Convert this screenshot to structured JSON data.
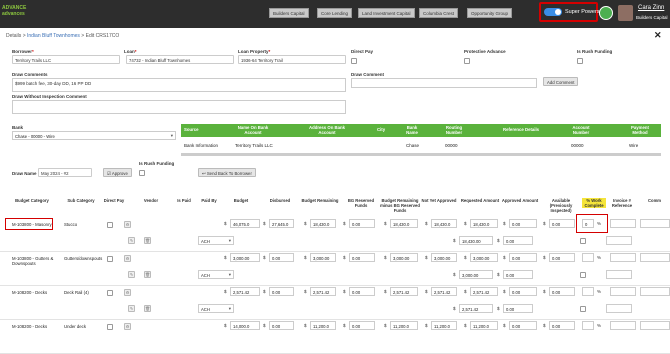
{
  "app": {
    "logo_line1": "ADVANCE",
    "logo_line2": "advances"
  },
  "nav": {
    "tabs": [
      "Builders Capital",
      "Core Lending",
      "Land Investment Capital",
      "Columbia Crest",
      "Opportunity Group"
    ],
    "super_powers_label": "Super Powers",
    "user_name": "Cara Zinn",
    "user_company": "Builders Capital"
  },
  "breadcrumb": {
    "root": "Details",
    "sep": ">",
    "project": "Indian Bluff Townhomes",
    "current": "Edit CRS17CO"
  },
  "form": {
    "borrower_label": "Borrower",
    "borrower_value": "Territory Trails LLC",
    "loan_label": "Loan",
    "loan_value": "74732 - Indian Bluff Townhomes",
    "loan_property_label": "Loan Property",
    "loan_property_value": "1936-64 Territory Trail",
    "direct_pay_label": "Direct Pay",
    "protective_advance_label": "Protective Advance",
    "is_rush_label": "Is Rush Funding",
    "draw_comments_label": "Draw Comments",
    "draw_comments_value": "$999 batch fee, 30-day DD, 16 PP DD",
    "draw_comment_label": "Draw Comment",
    "add_comment_button": "Add Comment",
    "draw_without_label": "Draw Without Inspection Comment",
    "bank_label": "Bank",
    "bank_value": "Chase - 00000 - Wire",
    "draw_name_label": "Draw Name",
    "draw_name_value": "May 2024 - #2",
    "approve_button": "Approve",
    "is_rush_label2": "Is Rush Funding",
    "send_back_button": "Send Back To Borrower"
  },
  "bank_table": {
    "headers": [
      "Source",
      "Name On Bank Account",
      "Address On Bank Account",
      "City",
      "Bank Name",
      "Routing Number",
      "Reference Details",
      "Account Number",
      "Payment Method"
    ],
    "row": [
      "Bank Information",
      "Territory Trails LLC",
      "",
      "",
      "Chase",
      "00000",
      "",
      "00000",
      "Wire"
    ]
  },
  "budget_table": {
    "headers": [
      "Budget Category",
      "Sub Category",
      "Direct Pay",
      "Vendor",
      "Is Paid",
      "Paid By",
      "Budget",
      "Disbursed",
      "Budget Remaining",
      "BG Reserved Funds",
      "Budget Remaining minus BG Reserved Funds",
      "Not Yet Approved",
      "Requested Amount",
      "Approved Amount",
      "Available (Previously Inspected)",
      "% Work Complete",
      "Invoice # Reference",
      "Comm"
    ],
    "rows": [
      {
        "category": "M-103800 - Masonry",
        "sub": "Stucco",
        "paid_by": "ACH",
        "budget": "46,075.0",
        "disbursed": "27,645.0",
        "remaining": "18,430.0",
        "bg": "0.00",
        "rem_minus": "18,430.0",
        "nya": "18,430.0",
        "req": "18,430.0",
        "appr": "0.00",
        "avail": "0.00",
        "pct": "0",
        "req2": "18,430.00",
        "appr2": "0.00"
      },
      {
        "category": "M-103800 - Gutters & Downspouts",
        "sub": "Gutters/downspouts",
        "paid_by": "ACH",
        "budget": "3,000.00",
        "disbursed": "0.00",
        "remaining": "3,000.00",
        "bg": "0.00",
        "rem_minus": "3,000.00",
        "nya": "3,000.00",
        "req": "3,000.00",
        "appr": "0.00",
        "avail": "0.00",
        "pct": "",
        "req2": "3,000.00",
        "appr2": "0.00"
      },
      {
        "category": "M-108200 - Decks",
        "sub": "Deck Rail (4)",
        "paid_by": "ACH",
        "budget": "2,571.42",
        "disbursed": "0.00",
        "remaining": "2,571.42",
        "bg": "0.00",
        "rem_minus": "2,571.42",
        "nya": "2,571.42",
        "req": "2,571.42",
        "appr": "0.00",
        "avail": "0.00",
        "pct": "",
        "req2": "2,571.42",
        "appr2": "0.00"
      },
      {
        "category": "M-108200 - Decks",
        "sub": "Under deck",
        "paid_by": "ACH",
        "budget": "14,000.0",
        "disbursed": "0.00",
        "remaining": "11,200.0",
        "bg": "0.00",
        "rem_minus": "11,200.0",
        "nya": "11,200.0",
        "req": "11,200.0",
        "appr": "0.00",
        "avail": "0.00",
        "pct": "",
        "req2": "",
        "appr2": ""
      }
    ]
  },
  "colors": {
    "topbar": "#2d2d2d",
    "accent_green": "#5ab23c",
    "highlight_red": "#d40000",
    "yellow": "#f5e53a",
    "toggle": "#3a8ee6"
  }
}
